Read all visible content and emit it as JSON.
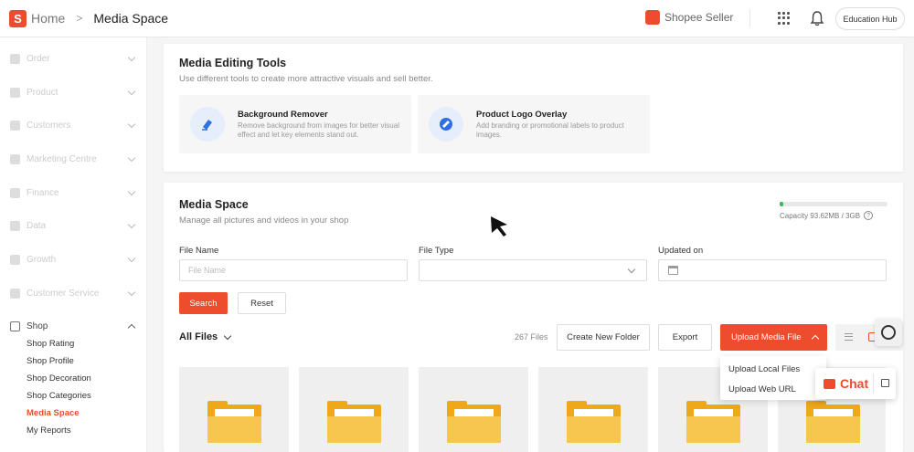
{
  "header": {
    "logo_letter": "S",
    "breadcrumb_home": "Home",
    "breadcrumb_separator": ">",
    "breadcrumb_current": "Media Space",
    "seller_label": "Shopee Seller",
    "education_hub": "Education Hub"
  },
  "sidebar": {
    "groups": [
      {
        "label": "Order"
      },
      {
        "label": "Product"
      },
      {
        "label": "Customers"
      },
      {
        "label": "Marketing Centre"
      },
      {
        "label": "Finance"
      },
      {
        "label": "Data"
      },
      {
        "label": "Growth"
      },
      {
        "label": "Customer Service"
      }
    ],
    "shop": {
      "label": "Shop",
      "items": [
        "Shop Rating",
        "Shop Profile",
        "Shop Decoration",
        "Shop Categories",
        "Media Space",
        "My Reports"
      ],
      "active": "Media Space"
    }
  },
  "tools": {
    "title": "Media Editing Tools",
    "subtitle": "Use different tools to create more attractive visuals and sell better.",
    "items": [
      {
        "title": "Background Remover",
        "desc": "Remove background from images for better visual effect and let key elements stand out.",
        "icon": "eraser-icon"
      },
      {
        "title": "Product Logo Overlay",
        "desc": "Add branding or promotional labels to product images.",
        "icon": "logo-overlay-icon"
      }
    ]
  },
  "media": {
    "title": "Media Space",
    "subtitle": "Manage all pictures and videos in your shop",
    "capacity_text": "Capacity 93.62MB / 3GB",
    "capacity_fraction": 0.03,
    "help": "?",
    "filters": {
      "file_name_label": "File Name",
      "file_name_placeholder": "File Name",
      "file_type_label": "File Type",
      "file_type_value": "",
      "updated_label": "Updated on"
    },
    "search_label": "Search",
    "reset_label": "Reset",
    "all_files_label": "All Files",
    "file_count": "267 Files",
    "create_folder_label": "Create New Folder",
    "export_label": "Export",
    "upload_label": "Upload Media File",
    "upload_menu": [
      "Upload Local Files",
      "Upload Web URL"
    ]
  },
  "chat": {
    "label": "Chat"
  },
  "colors": {
    "accent": "#ee4d2d",
    "folder": "#f0a81b",
    "capacity": "#2ebd59"
  }
}
